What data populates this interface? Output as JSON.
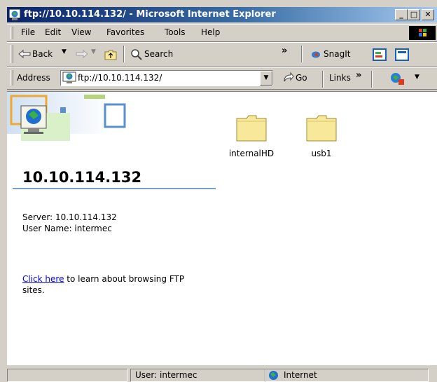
{
  "window": {
    "title": "ftp://10.10.114.132/ - Microsoft Internet Explorer"
  },
  "menu": [
    "File",
    "Edit",
    "View",
    "Favorites",
    "Tools",
    "Help"
  ],
  "toolbar": {
    "back": "Back",
    "search": "Search",
    "chevrons": "»",
    "snagit": "SnagIt"
  },
  "address": {
    "label": "Address",
    "value": "ftp://10.10.114.132/",
    "go": "Go",
    "links": "Links",
    "links_chevron": "»"
  },
  "panel": {
    "host_title": "10.10.114.132",
    "server_line": "Server: 10.10.114.132",
    "user_line": "User Name: intermec",
    "link_text": "Click here",
    "link_rest_1": " to learn about browsing FTP",
    "link_rest_2": "sites."
  },
  "folders": [
    "internalHD",
    "usb1"
  ],
  "status": {
    "user": "User: intermec",
    "zone": "Internet"
  },
  "icons": [
    "ie-globe-icon",
    "folder-icon",
    "back-arrow-icon",
    "forward-arrow-icon",
    "up-folder-icon",
    "search-icon",
    "snagit-icon",
    "go-arrow-icon",
    "internet-zone-icon"
  ],
  "colors": {
    "titlebar_start": "#0a246a",
    "titlebar_end": "#a6caf0",
    "link": "#0000ff",
    "folder": "#f7e89a"
  }
}
